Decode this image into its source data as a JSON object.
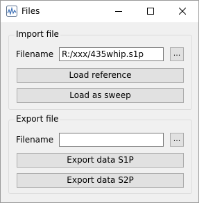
{
  "window": {
    "title": "Files",
    "icons": {
      "app": "app-icon",
      "minimize": "minimize-icon",
      "maximize": "maximize-icon",
      "close": "close-icon"
    }
  },
  "import": {
    "legend": "Import file",
    "filename_label": "Filename",
    "filename_value": "R:/xxx/435whip.s1p",
    "browse_label": "...",
    "load_reference_label": "Load reference",
    "load_sweep_label": "Load as sweep"
  },
  "export": {
    "legend": "Export file",
    "filename_label": "Filename",
    "filename_value": "",
    "browse_label": "...",
    "export_s1p_label": "Export data S1P",
    "export_s2p_label": "Export data S2P"
  }
}
